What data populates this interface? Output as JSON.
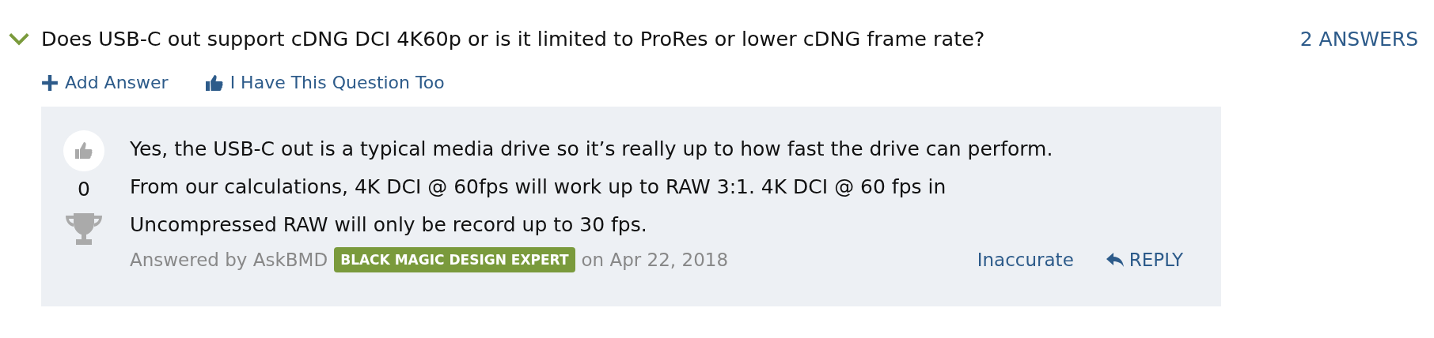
{
  "question": {
    "expanded": true,
    "title": "Does USB-C out support cDNG DCI 4K60p or is it limited to ProRes or lower cDNG frame rate?",
    "answer_count": "2 ANSWERS"
  },
  "actions": [
    {
      "kind": "add",
      "label": "Add Answer"
    },
    {
      "kind": "thumb",
      "label": "I Have This Question Too"
    }
  ],
  "answer": {
    "votes": "0",
    "body": "Yes, the USB-C out is a typical media drive so it’s really up to how fast the drive can perform. From our calculations, 4K DCI @ 60fps will work up to RAW 3:1. 4K DCI @ 60 fps in Uncompressed RAW will only be record up to 30 fps.",
    "byline": "Answered by AskBMD",
    "badge": "BLACK MAGIC DESIGN EXPERT",
    "date": "on Apr 22, 2018",
    "flag_link": "Inaccurate",
    "reply_link": "REPLY"
  }
}
